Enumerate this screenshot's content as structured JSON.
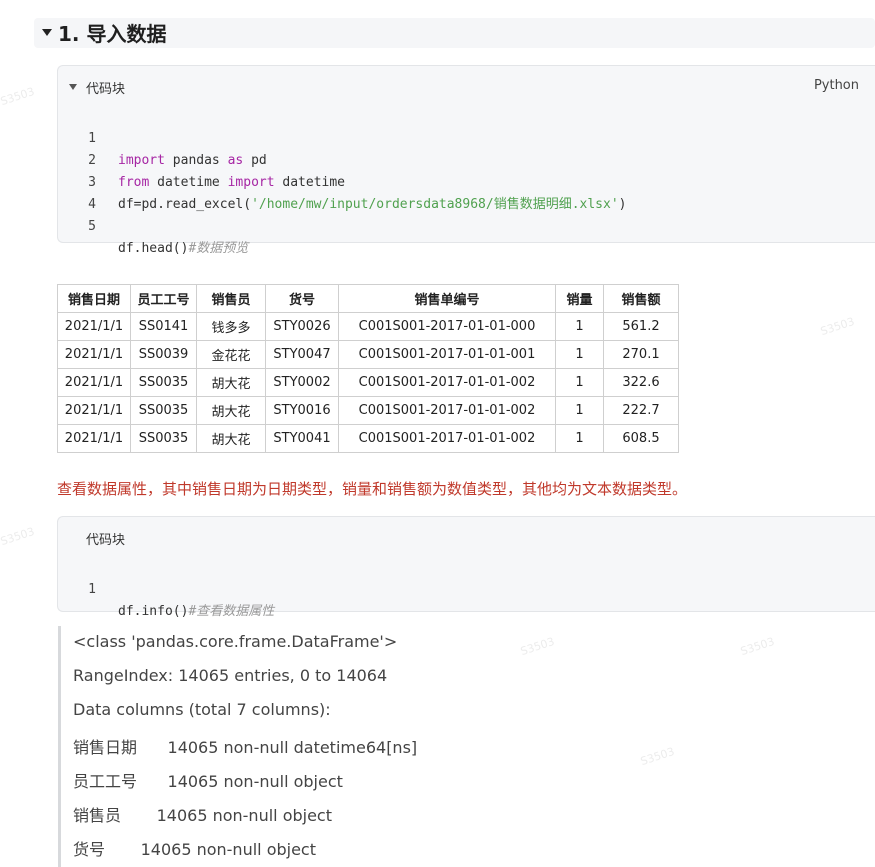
{
  "section": {
    "title": "1. 导入数据"
  },
  "code_block_1": {
    "title": "代码块",
    "language": "Python",
    "lines": [
      {
        "num": "1"
      },
      {
        "num": "2"
      },
      {
        "num": "3"
      },
      {
        "num": "4"
      },
      {
        "num": "5"
      }
    ],
    "tokens": {
      "l1_kw1": "import",
      "l1_t1": " pandas ",
      "l1_kw2": "as",
      "l1_t2": " pd",
      "l2_kw1": "from",
      "l2_t1": " datetime ",
      "l2_kw2": "import",
      "l2_t2": " datetime",
      "l3_t1": "df=pd.read_excel(",
      "l3_str": "'/home/mw/input/ordersdata8968/销售数据明细.xlsx'",
      "l3_t2": ")",
      "l5_t1": "df.head()",
      "l5_cmt": "#数据预览"
    }
  },
  "table": {
    "headers": [
      "销售日期",
      "员工工号",
      "销售员",
      "货号",
      "销售单编号",
      "销量",
      "销售额"
    ],
    "rows": [
      [
        "2021/1/1",
        "SS0141",
        "钱多多",
        "STY0026",
        "C001S001-2017-01-01-000",
        "1",
        "561.2"
      ],
      [
        "2021/1/1",
        "SS0039",
        "金花花",
        "STY0047",
        "C001S001-2017-01-01-001",
        "1",
        "270.1"
      ],
      [
        "2021/1/1",
        "SS0035",
        "胡大花",
        "STY0002",
        "C001S001-2017-01-01-002",
        "1",
        "322.6"
      ],
      [
        "2021/1/1",
        "SS0035",
        "胡大花",
        "STY0016",
        "C001S001-2017-01-01-002",
        "1",
        "222.7"
      ],
      [
        "2021/1/1",
        "SS0035",
        "胡大花",
        "STY0041",
        "C001S001-2017-01-01-002",
        "1",
        "608.5"
      ]
    ]
  },
  "note": "查看数据属性，其中销售日期为日期类型，销量和销售额为数值类型，其他均为文本数据类型。",
  "code_block_2": {
    "title": "代码块",
    "line_num": "1",
    "code": "df.info()",
    "comment": "#查看数据属性"
  },
  "output": {
    "lines": [
      "<class 'pandas.core.frame.DataFrame'>",
      "RangeIndex: 14065 entries, 0 to 14064",
      "Data columns (total 7 columns):",
      "销售日期      14065 non-null datetime64[ns]",
      "员工工号      14065 non-null object",
      "销售员       14065 non-null object",
      "货号       14065 non-null object"
    ]
  },
  "colors": {
    "keyword": "#a626a4",
    "string": "#50a14f",
    "comment": "#999999",
    "note": "#c0392b"
  }
}
